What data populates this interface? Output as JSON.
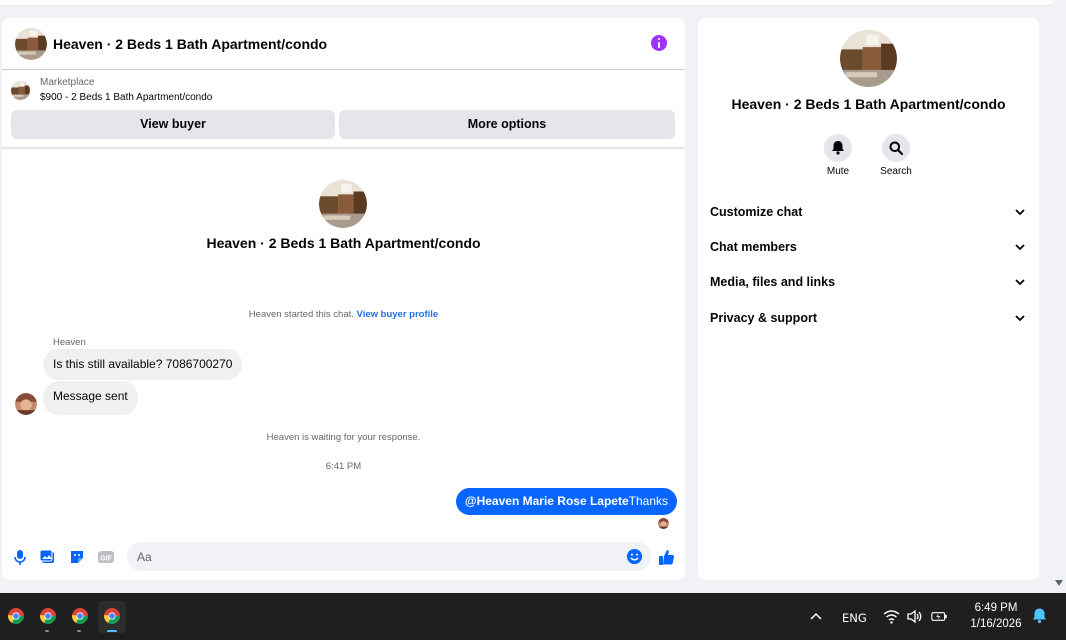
{
  "chat": {
    "title": "Heaven · 2 Beds 1 Bath Apartment/condo",
    "marketplace_label": "Marketplace",
    "listing": "$900 - 2 Beds 1 Bath Apartment/condo",
    "view_buyer_label": "View buyer",
    "more_options_label": "More options",
    "center_title": "Heaven · 2 Beds 1 Bath Apartment/condo",
    "started_text": "Heaven started this chat.",
    "view_profile_link": "View buyer profile",
    "sender_name": "Heaven",
    "messages_in": [
      "Is this still available? 7086700270",
      "Message sent"
    ],
    "waiting_text": "Heaven is waiting for your response.",
    "time": "6:41 PM",
    "out_mention": "@Heaven Marie Rose Lapete",
    "out_text": "Thanks",
    "composer_placeholder": "Aa"
  },
  "info": {
    "title": "Heaven · 2 Beds 1 Bath Apartment/condo",
    "mute_label": "Mute",
    "search_label": "Search",
    "menu": [
      "Customize chat",
      "Chat members",
      "Media, files and links",
      "Privacy & support"
    ]
  },
  "taskbar": {
    "apps": [
      "chrome-icon",
      "chrome-icon",
      "chrome-icon",
      "chrome-icon"
    ],
    "lang": "ENG",
    "time": "6:49 PM",
    "date": "1/16/2026"
  },
  "colors": {
    "accent": "#0866ff",
    "info": "#a033ff",
    "link": "#1b74e4",
    "taskbar": "#1f1f1f"
  }
}
